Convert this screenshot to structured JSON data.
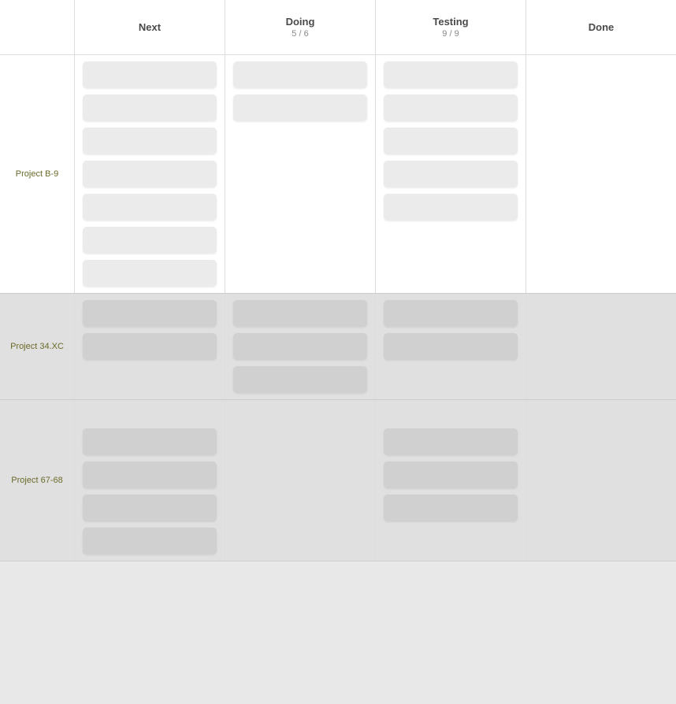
{
  "header": {
    "columns": [
      {
        "id": "label",
        "title": "",
        "count": ""
      },
      {
        "id": "next",
        "title": "Next",
        "count": ""
      },
      {
        "id": "doing",
        "title": "Doing",
        "count": "5 / 6"
      },
      {
        "id": "testing",
        "title": "Testing",
        "count": "9 / 9"
      },
      {
        "id": "done",
        "title": "Done",
        "count": ""
      }
    ]
  },
  "projects": [
    {
      "id": "project-b9",
      "label": "Project B-9",
      "bg": "white",
      "next_cards": 7,
      "doing_cards": 2,
      "testing_cards": 5,
      "done_cards": 0
    },
    {
      "id": "project-34xc",
      "label": "Project 34.XC",
      "bg": "gray",
      "next_cards": 2,
      "doing_cards": 3,
      "testing_cards": 2,
      "done_cards": 0
    },
    {
      "id": "project-67-68",
      "label": "Project 67-68",
      "bg": "gray",
      "next_cards": 4,
      "doing_cards": 0,
      "testing_cards": 3,
      "done_cards": 0
    }
  ]
}
